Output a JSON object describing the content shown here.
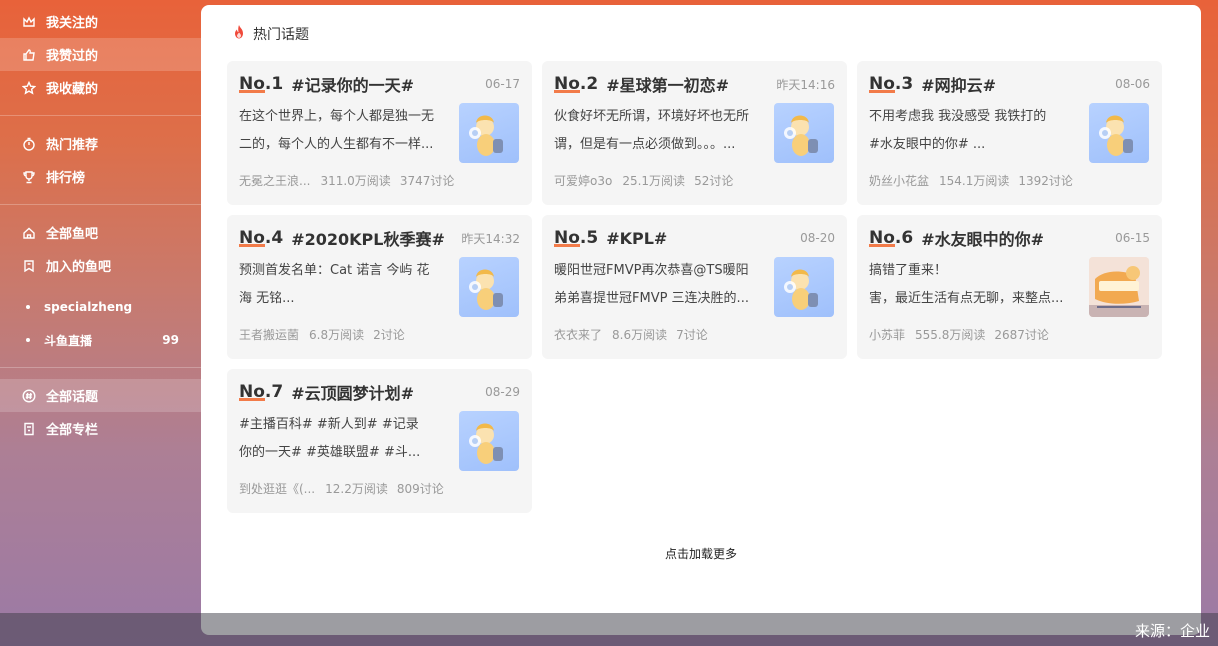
{
  "sidebar": {
    "group1": [
      {
        "label": "我关注的",
        "icon": "crown-icon"
      },
      {
        "label": "我赞过的",
        "icon": "thumbs-up-icon"
      },
      {
        "label": "我收藏的",
        "icon": "star-icon"
      }
    ],
    "group2": [
      {
        "label": "热门推荐",
        "icon": "stopwatch-icon"
      },
      {
        "label": "排行榜",
        "icon": "trophy-icon"
      }
    ],
    "group3": [
      {
        "label": "全部鱼吧",
        "icon": "home-icon"
      },
      {
        "label": "加入的鱼吧",
        "icon": "bookmark-icon"
      }
    ],
    "sub": [
      {
        "label": "specialzheng",
        "count": ""
      },
      {
        "label": "斗鱼直播",
        "count": "99"
      }
    ],
    "group4": [
      {
        "label": "全部话题",
        "icon": "hash-icon"
      },
      {
        "label": "全部专栏",
        "icon": "document-icon"
      }
    ]
  },
  "main": {
    "title": "热门话题",
    "load_more": "点击加载更多",
    "cards": [
      {
        "rank": "No.1",
        "topic": "#记录你的一天#",
        "date": "06-17",
        "line1": "在这个世界上，每个人都是独一无",
        "line2": "二的，每个人的人生都有不一样...",
        "author": "无冕之王浪...",
        "reads": "311.0万阅读",
        "comments": "3747讨论"
      },
      {
        "rank": "No.2",
        "topic": "#星球第一初恋#",
        "date": "昨天14:16",
        "line1": "伙食好坏无所谓，环境好坏也无所",
        "line2": "谓，但是有一点必须做到。。。...",
        "author": "可爱婷o3o",
        "reads": "25.1万阅读",
        "comments": "52讨论"
      },
      {
        "rank": "No.3",
        "topic": "#网抑云#",
        "date": "08-06",
        "line1": "不用考虑我  我没感受  我铁打的",
        "line2": "  #水友眼中的你#  ...",
        "author": "奶丝小花盆",
        "reads": "154.1万阅读",
        "comments": "1392讨论"
      },
      {
        "rank": "No.4",
        "topic": "#2020KPL秋季赛#",
        "date": "昨天14:32",
        "line1": "预测首发名单：Cat 诺言 今屿 花",
        "line2": "海 无铭...",
        "author": "王者搬运菌",
        "reads": "6.8万阅读",
        "comments": "2讨论"
      },
      {
        "rank": "No.5",
        "topic": "#KPL#",
        "date": "08-20",
        "line1": "暖阳世冠FMVP再次恭喜@TS暖阳",
        "line2": "弟弟喜提世冠FMVP 三连决胜的...",
        "author": "衣衣来了",
        "reads": "8.6万阅读",
        "comments": "7讨论"
      },
      {
        "rank": "No.6",
        "topic": "#水友眼中的你#",
        "date": "06-15",
        "line1": "搞错了重来！",
        "line2": "害，最近生活有点无聊，来整点...",
        "author": "小苏菲",
        "reads": "555.8万阅读",
        "comments": "2687讨论"
      },
      {
        "rank": "No.7",
        "topic": "#云顶圆梦计划#",
        "date": "08-29",
        "line1": " #主播百科#   #新人到#   #记录",
        "line2": "你的一天#   #英雄联盟#   #斗...",
        "author": "到处逛逛《(...",
        "reads": "12.2万阅读",
        "comments": "809讨论"
      }
    ]
  },
  "footer": {
    "source": "来源：企业"
  },
  "colors": {
    "accent": "#f1652a",
    "card_bg": "#f5f5f5"
  }
}
